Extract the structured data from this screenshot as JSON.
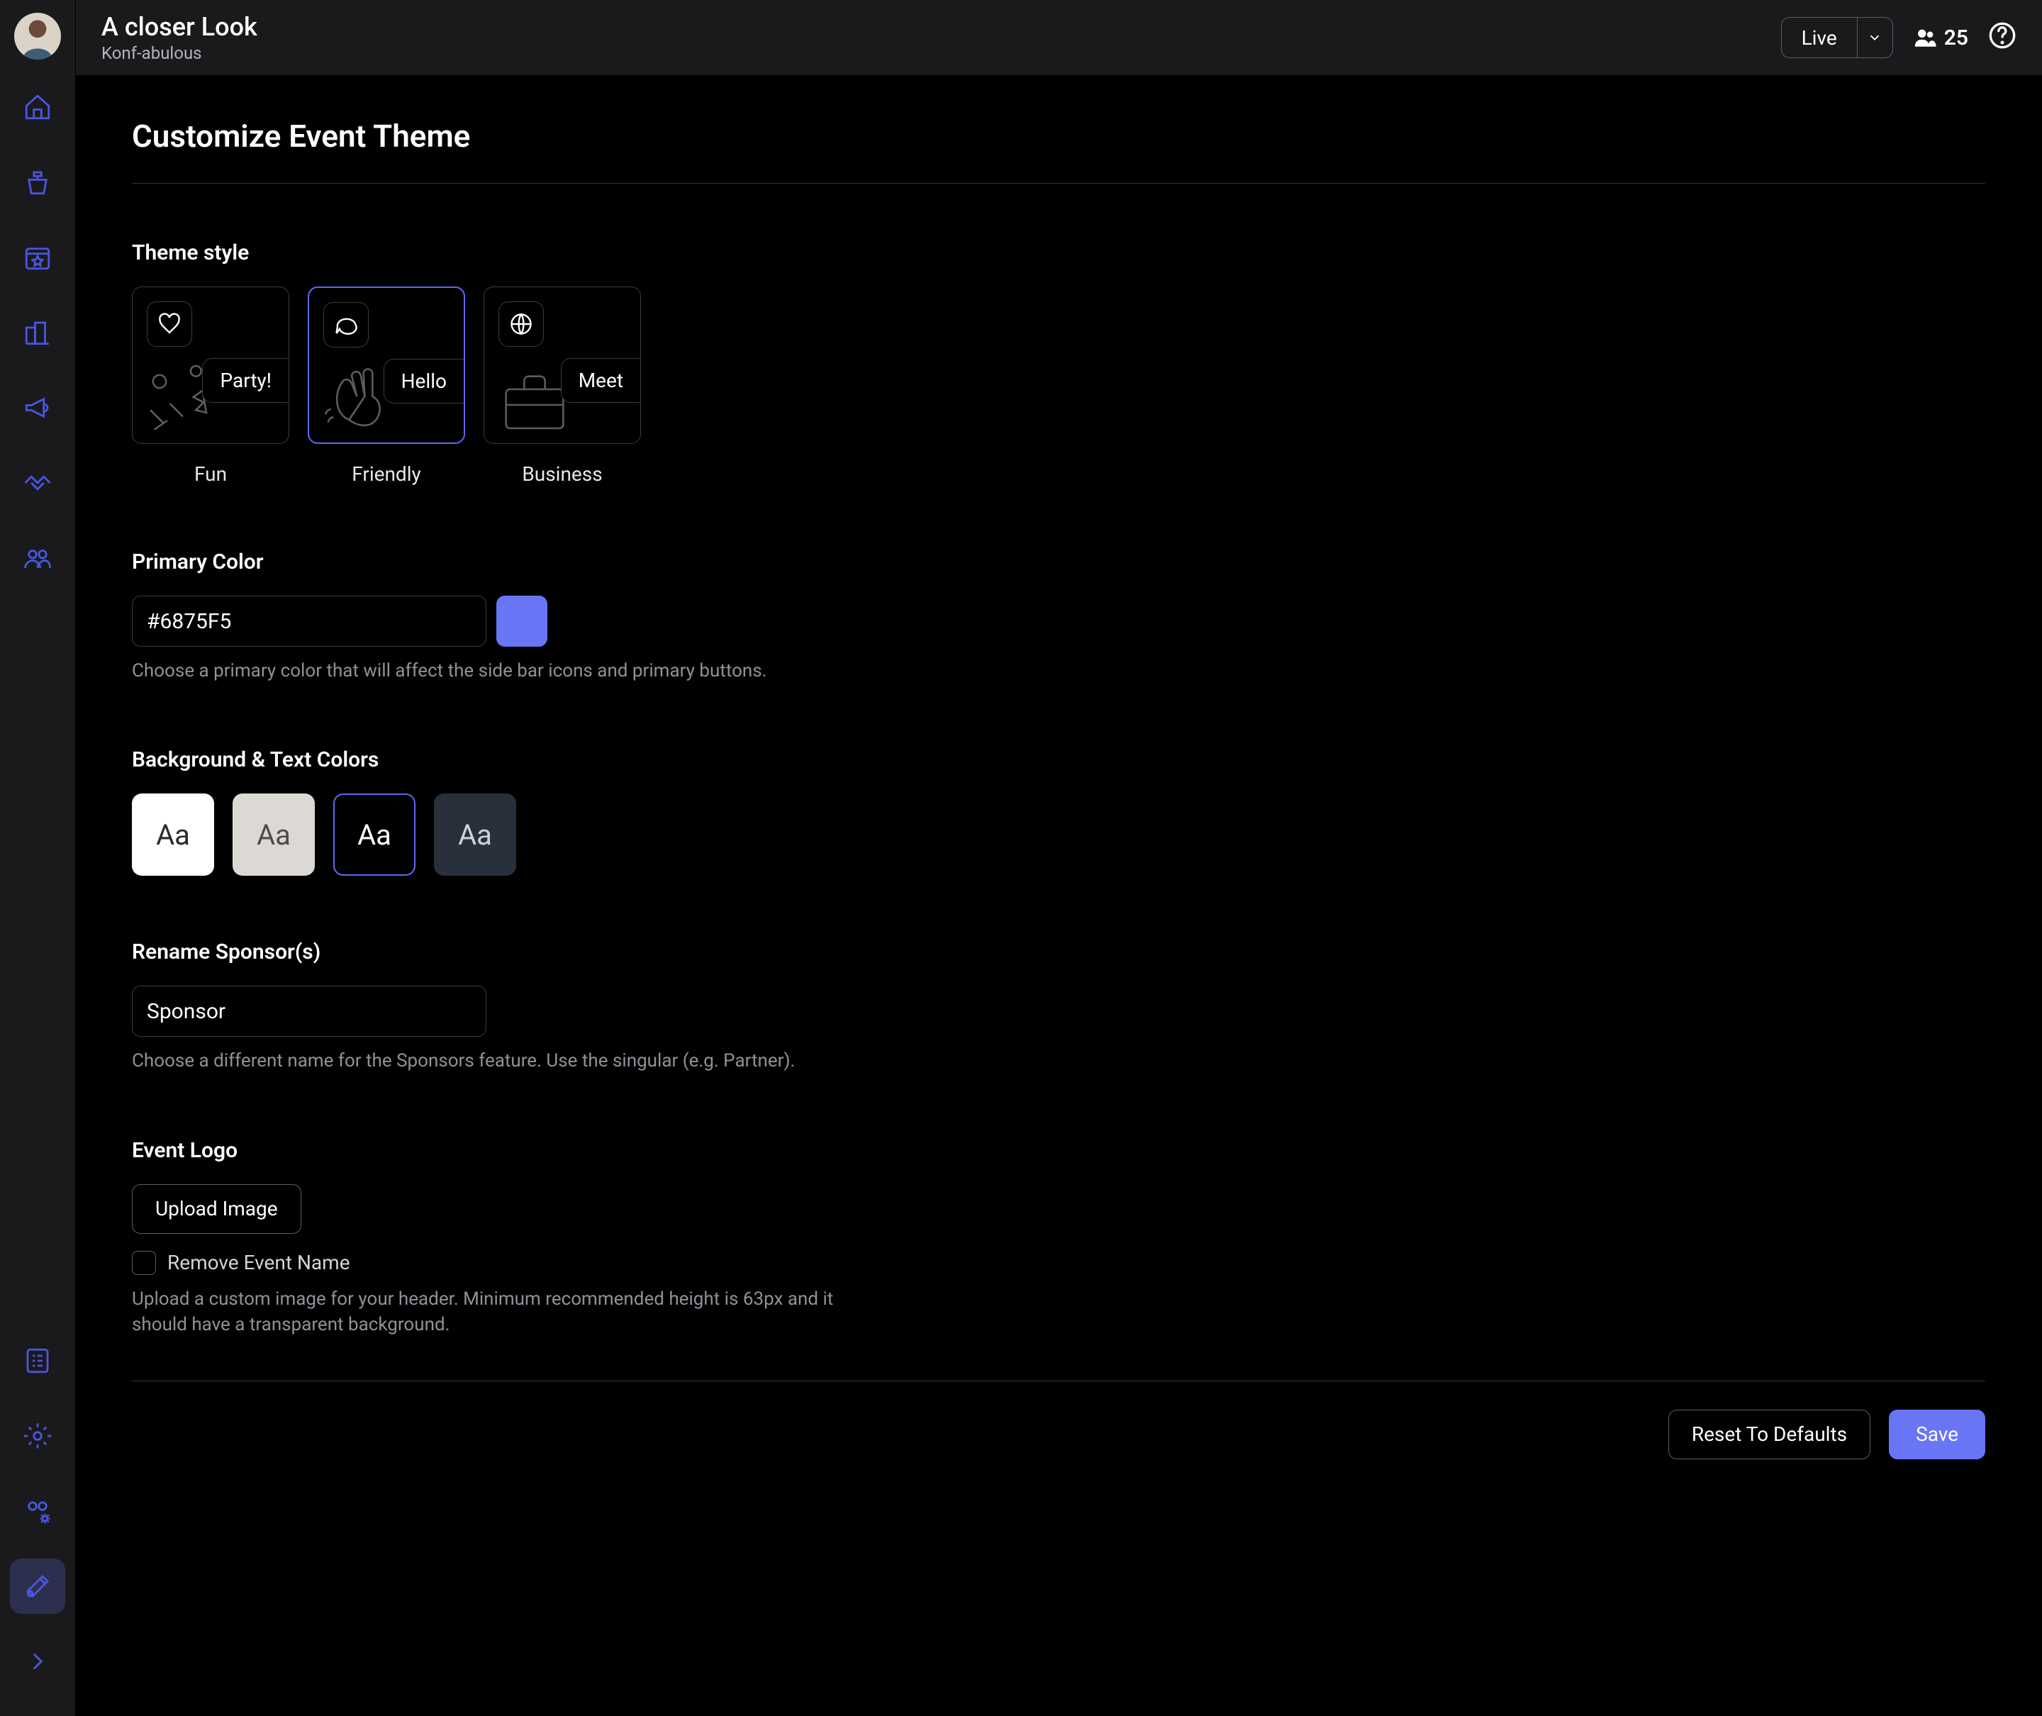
{
  "header": {
    "title": "A closer Look",
    "subtitle": "Konf-abulous",
    "live_label": "Live",
    "attendee_count": "25"
  },
  "page": {
    "heading": "Customize Event Theme"
  },
  "theme_style": {
    "label": "Theme style",
    "options": [
      {
        "tag": "Party!",
        "label": "Fun"
      },
      {
        "tag": "Hello",
        "label": "Friendly"
      },
      {
        "tag": "Meet",
        "label": "Business"
      }
    ],
    "selected_index": 1
  },
  "primary_color": {
    "label": "Primary Color",
    "value": "#6875F5",
    "hint": "Choose a primary color that will affect the side bar icons and primary buttons."
  },
  "bg_text": {
    "label": "Background & Text Colors",
    "sample": "Aa",
    "selected_index": 2
  },
  "sponsor": {
    "label": "Rename Sponsor(s)",
    "value": "Sponsor",
    "hint": "Choose a different name for the Sponsors feature. Use the singular (e.g. Partner)."
  },
  "logo": {
    "label": "Event Logo",
    "upload_label": "Upload Image",
    "checkbox_label": "Remove Event Name",
    "hint": "Upload a custom image for your header. Minimum recommended height is 63px and it should have a transparent background."
  },
  "footer": {
    "reset_label": "Reset To Defaults",
    "save_label": "Save"
  }
}
